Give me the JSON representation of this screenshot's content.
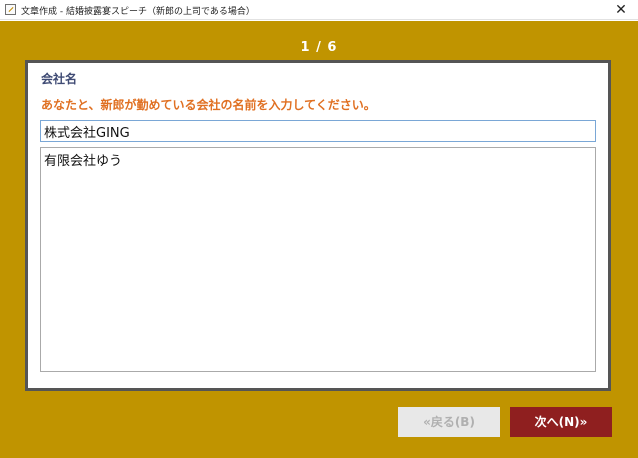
{
  "window": {
    "title": "文章作成 - 結婚披露宴スピーチ（新郎の上司である場合）",
    "close_glyph": "✕"
  },
  "wizard": {
    "page_indicator": "1 / 6",
    "field_label": "会社名",
    "instruction": "あなたと、新郎が勤めている会社の名前を入力してください。",
    "input_value": "株式会社GING",
    "preview_text": "有限会社ゆう"
  },
  "buttons": {
    "back_label": "«戻る(B)",
    "next_label": "次へ(N)»"
  },
  "colors": {
    "background": "#c09400",
    "panel_border": "#555555",
    "label": "#3f4b74",
    "instruction": "#e07022",
    "next_button": "#8f1f1f",
    "back_button_disabled": "#e8e8e8"
  }
}
